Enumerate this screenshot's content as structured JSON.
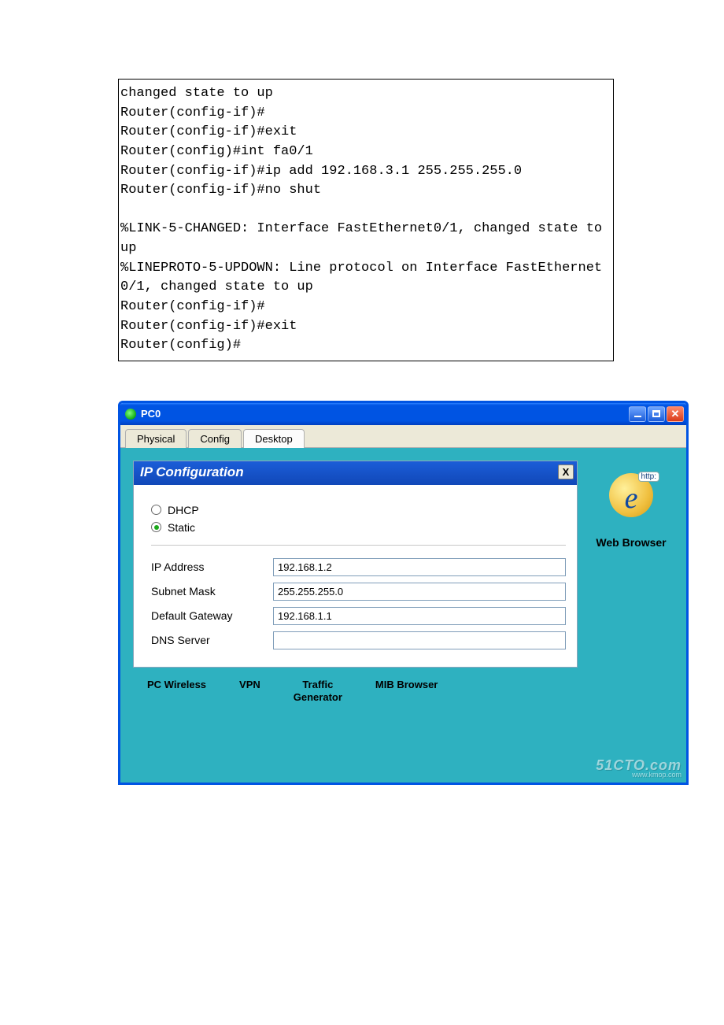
{
  "cli": {
    "lines": [
      "changed state to up",
      "Router(config-if)#",
      "Router(config-if)#exit",
      "Router(config)#int fa0/1",
      "Router(config-if)#ip add 192.168.3.1 255.255.255.0",
      "Router(config-if)#no shut",
      "",
      "%LINK-5-CHANGED: Interface FastEthernet0/1, changed state to up",
      "%LINEPROTO-5-UPDOWN: Line protocol on Interface FastEthernet0/1, changed state to up",
      "Router(config-if)#",
      "Router(config-if)#exit",
      "Router(config)#"
    ]
  },
  "window": {
    "title": "PC0",
    "tabs": [
      "Physical",
      "Config",
      "Desktop"
    ],
    "active_tab": "Desktop"
  },
  "ipconf": {
    "header": "IP Configuration",
    "mode_options": {
      "dhcp": "DHCP",
      "static": "Static"
    },
    "selected_mode": "Static",
    "fields": {
      "ip_label": "IP Address",
      "ip_value": "192.168.1.2",
      "mask_label": "Subnet Mask",
      "mask_value": "255.255.255.0",
      "gw_label": "Default Gateway",
      "gw_value": "192.168.1.1",
      "dns_label": "DNS Server",
      "dns_value": ""
    }
  },
  "tools": {
    "pc_wireless": "PC Wireless",
    "vpn": "VPN",
    "traffic_gen": "Traffic\nGenerator",
    "mib": "MIB Browser"
  },
  "side": {
    "browser_label": "Web Browser",
    "http_badge": "http:"
  },
  "watermark": {
    "main": "51CTO.com",
    "sub": "www.kmop.com"
  }
}
